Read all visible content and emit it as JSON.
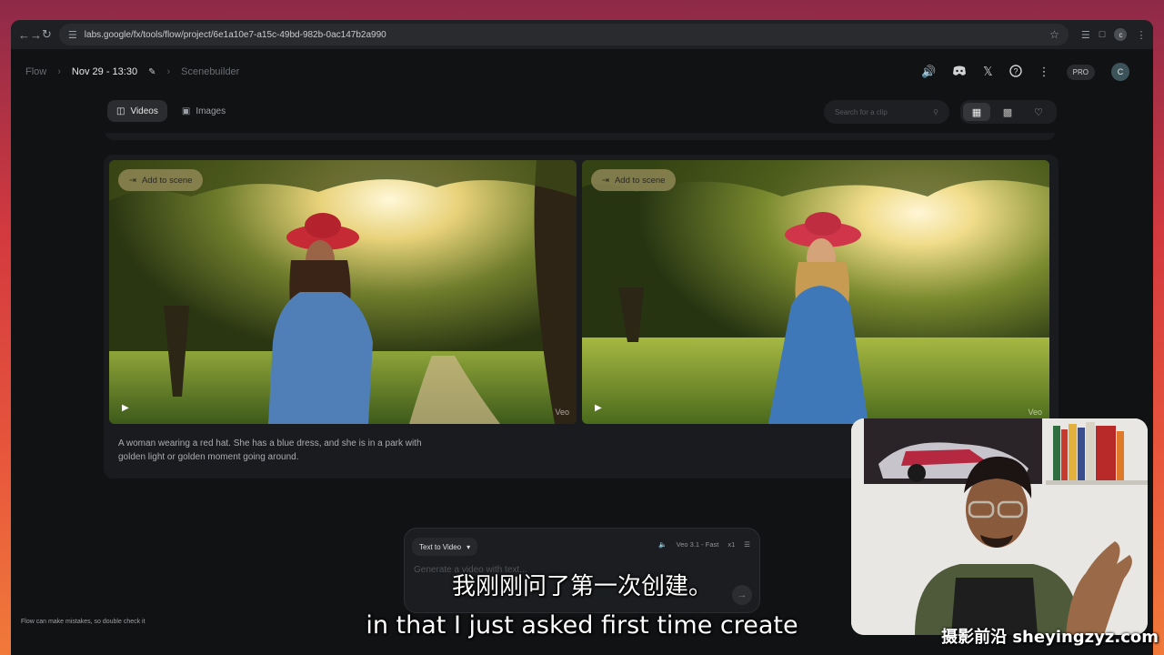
{
  "browser": {
    "url": "labs.google/fx/tools/flow/project/6e1a10e7-a15c-49bd-982b-0ac147b2a990",
    "profile_initial": "c"
  },
  "breadcrumb": {
    "app": "Flow",
    "project": "Nov 29 - 13:30",
    "section": "Scenebuilder"
  },
  "header": {
    "pro_label": "PRO",
    "avatar_initial": "C"
  },
  "tabs": [
    {
      "label": "Videos",
      "icon": "video-icon",
      "active": true
    },
    {
      "label": "Images",
      "icon": "image-icon",
      "active": false
    }
  ],
  "search": {
    "placeholder": "Search for a clip"
  },
  "clips": [
    {
      "add_label": "Add to scene",
      "tag": "Veo"
    },
    {
      "add_label": "Add to scene",
      "tag": "Veo"
    }
  ],
  "prompt": "A woman wearing a red hat. She has a blue dress, and she is in a park with golden light or golden moment going around.",
  "composer": {
    "mode": "Text to Video",
    "model": "Veo 3.1 - Fast",
    "count": "x1",
    "placeholder": "Generate a video with text..."
  },
  "disclaimer": "Flow can make mistakes, so double check it",
  "subtitles": {
    "cn": "我刚刚问了第一次创建。",
    "en": "in that I just asked first time create"
  },
  "watermark": "摄影前沿 sheyingzyz.com",
  "colors": {
    "accent_add_button": "#968c5a",
    "panel": "#1a1b1e",
    "app_bg": "#111214"
  }
}
